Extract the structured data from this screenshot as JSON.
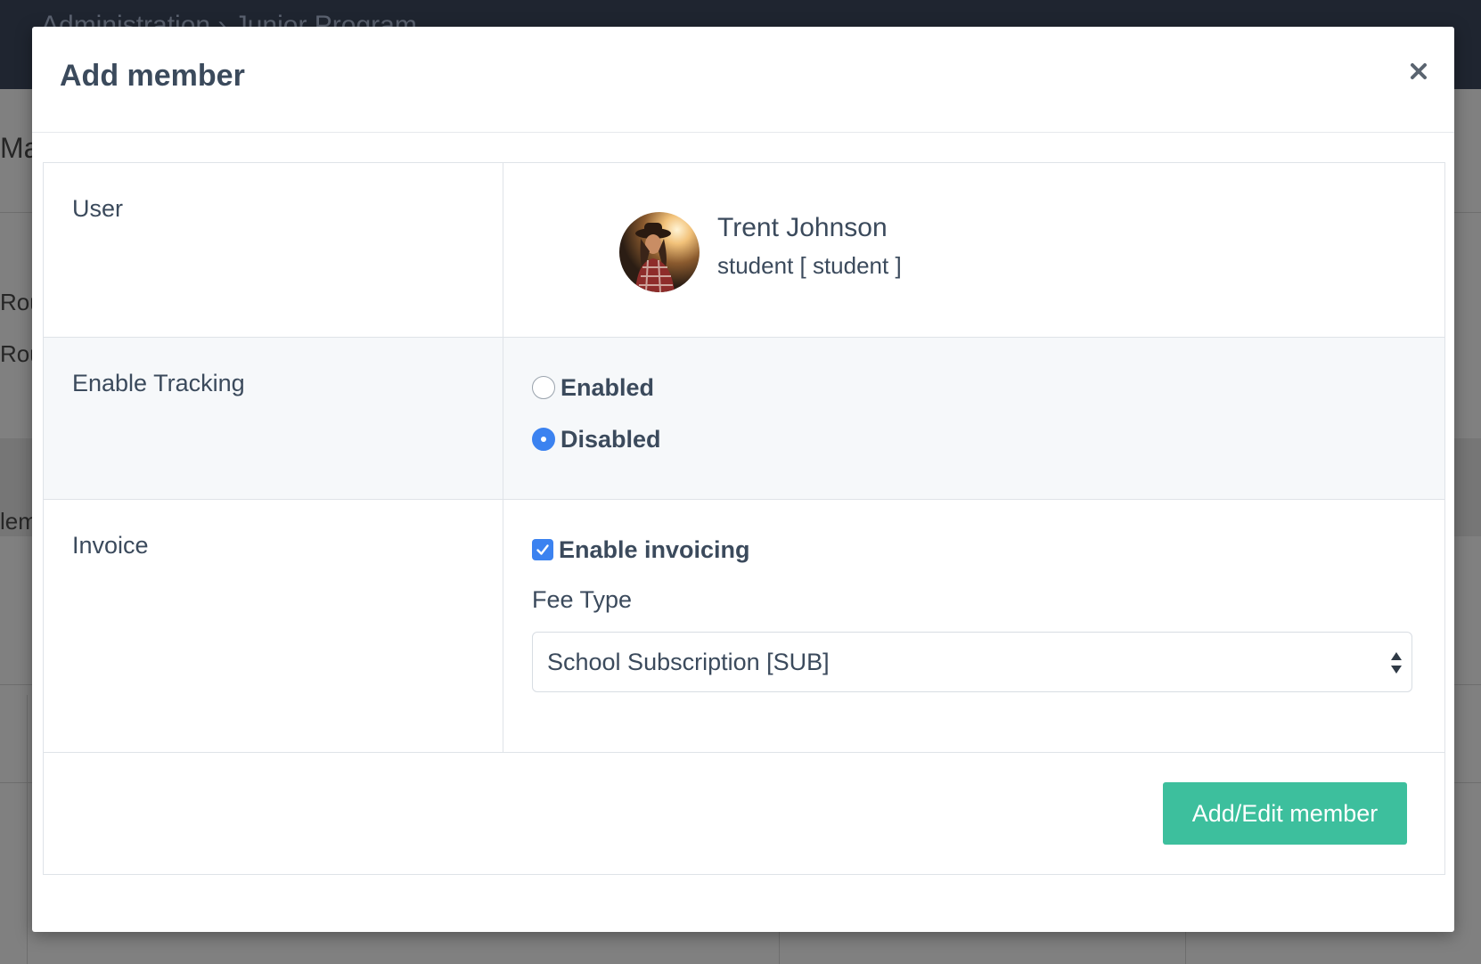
{
  "background": {
    "topbar_text": "Administration › Junior Program",
    "fragments": [
      "Ma",
      "Rou",
      "Rou",
      "lem"
    ]
  },
  "modal": {
    "title": "Add member",
    "close_icon": "close-icon"
  },
  "form": {
    "user": {
      "label": "User",
      "name": "Trent Johnson",
      "role": "student [ student ]",
      "avatar_icon": "avatar-photo"
    },
    "tracking": {
      "label": "Enable Tracking",
      "options": [
        {
          "label": "Enabled",
          "checked": false
        },
        {
          "label": "Disabled",
          "checked": true
        }
      ]
    },
    "invoice": {
      "label": "Invoice",
      "checkbox_label": "Enable invoicing",
      "checkbox_checked": true,
      "fee_type_label": "Fee Type",
      "fee_type_value": "School Subscription [SUB]"
    },
    "submit_label": "Add/Edit member"
  },
  "colors": {
    "accent_blue": "#3b82f0",
    "submit_green": "#3dbf9d",
    "text": "#3b4a5c"
  }
}
